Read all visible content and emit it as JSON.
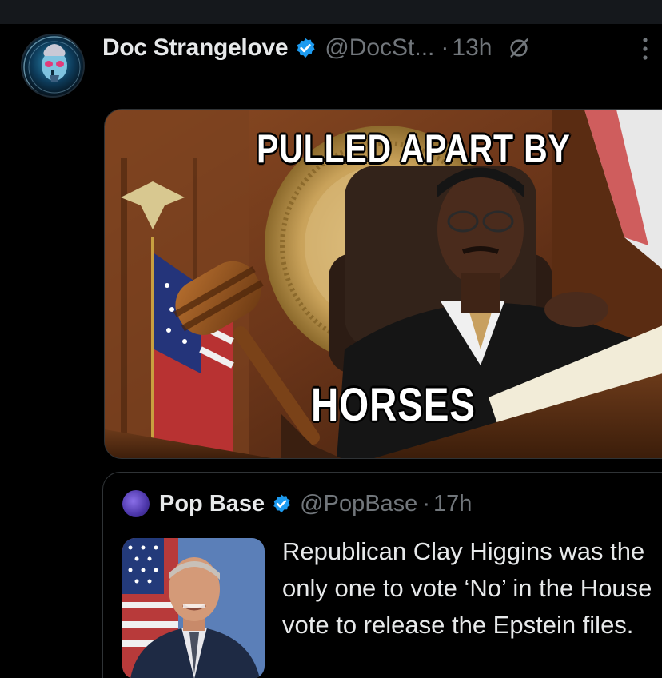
{
  "tweet": {
    "display_name": "Doc Strangelove",
    "handle": "@DocSt...",
    "separator": "·",
    "time": "13h",
    "avatar_icon": "skull-portrait-avatar",
    "verified_icon": "verified-badge-icon",
    "grok_icon": "grok-slash-icon",
    "more_icon": "more-options-icon",
    "media": {
      "top_caption": "PULLED APART BY",
      "bottom_caption": "HORSES"
    }
  },
  "quote": {
    "display_name": "Pop Base",
    "handle": "@PopBase",
    "separator": "·",
    "time": "17h",
    "text": "Republican Clay Higgins was the only one to vote ‘No’ in the House vote to release the Epstein files."
  },
  "colors": {
    "background": "#000000",
    "text_primary": "#e7e9ea",
    "text_secondary": "#71767b",
    "verified_blue": "#1d9bf0",
    "border": "#2f3336"
  }
}
